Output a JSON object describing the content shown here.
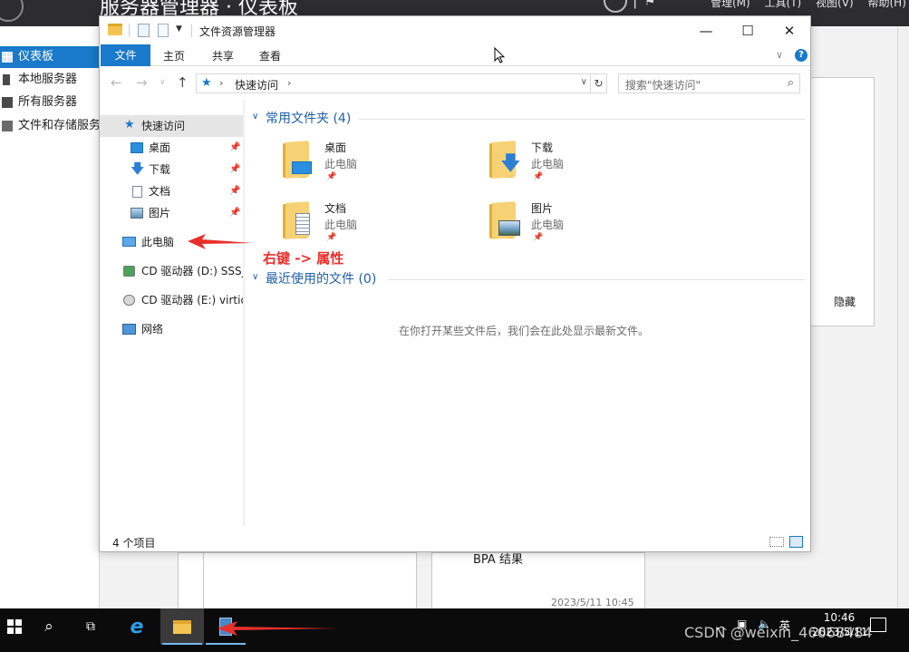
{
  "server_manager": {
    "title": "服务器管理器 · 仪表板",
    "menus": [
      "管理(M)",
      "工具(T)",
      "视图(V)",
      "帮助(H)"
    ],
    "nav_items": [
      {
        "label": "仪表板",
        "active": true
      },
      {
        "label": "本地服务器",
        "active": false
      },
      {
        "label": "所有服务器",
        "active": false
      },
      {
        "label": "文件和存储服务",
        "active": false
      }
    ],
    "hide_label": "隐藏",
    "bpa_label": "BPA 结果",
    "timestamp": "2023/5/11 10:45"
  },
  "explorer": {
    "title": "文件资源管理器",
    "ribbon_tabs": [
      "文件",
      "主页",
      "共享",
      "查看"
    ],
    "address_location": "快速访问",
    "search_placeholder": "搜索\"快速访问\"",
    "nav": {
      "quick_access": "快速访问",
      "pinned": [
        "桌面",
        "下载",
        "文档",
        "图片"
      ],
      "this_pc": "此电脑",
      "drive_d": "CD 驱动器 (D:) SSS_",
      "drive_e": "CD 驱动器 (E:) virtio",
      "network": "网络"
    },
    "groups": {
      "frequent": "常用文件夹 (4)",
      "recent": "最近使用的文件 (0)"
    },
    "folders": [
      {
        "name": "桌面",
        "location": "此电脑"
      },
      {
        "name": "下载",
        "location": "此电脑"
      },
      {
        "name": "文档",
        "location": "此电脑"
      },
      {
        "name": "图片",
        "location": "此电脑"
      }
    ],
    "recent_empty": "在你打开某些文件后，我们会在此处显示最新文件。",
    "status": "4 个项目"
  },
  "annotation": {
    "text": "右键 -> 属性",
    "color": "#e8302c"
  },
  "taskbar": {
    "time": "10:46",
    "date": "2023/5/11",
    "ime": "英"
  },
  "watermark": "CSDN @weixin_46668484",
  "colors": {
    "accent": "#1979ca",
    "group_title": "#1e5fa8",
    "header_bg": "#2d2d30"
  }
}
